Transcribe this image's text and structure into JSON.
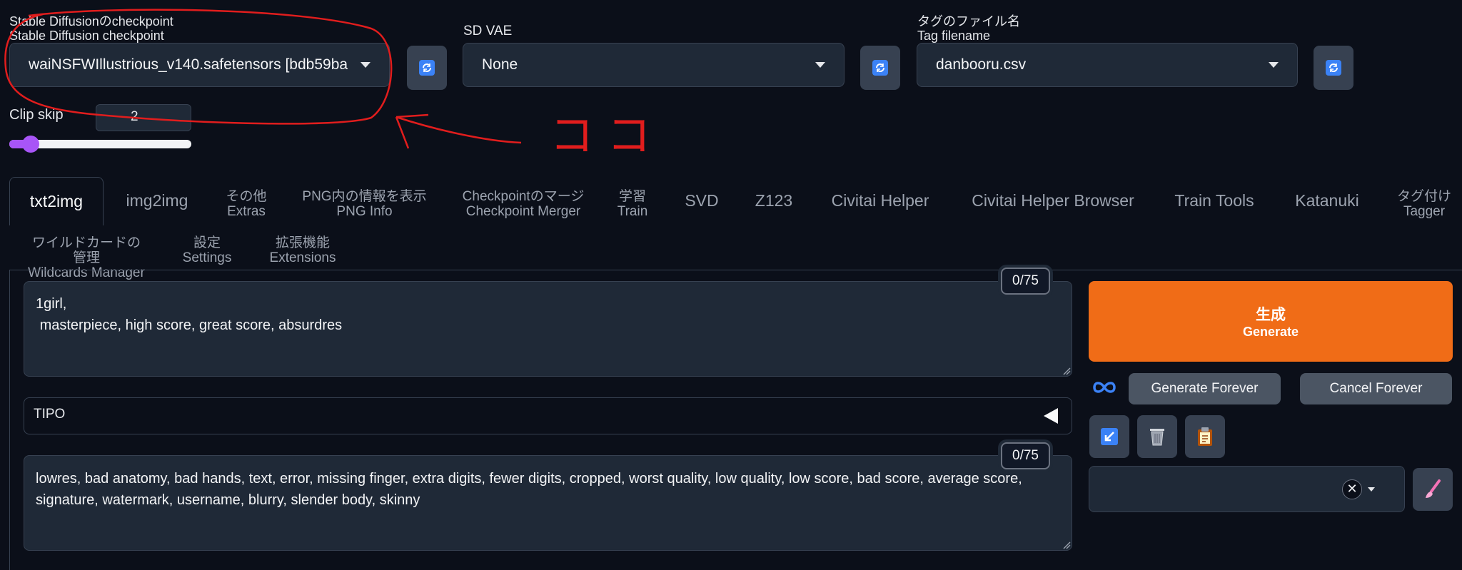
{
  "checkpoint": {
    "label_ja": "Stable Diffusionのcheckpoint",
    "label_en": "Stable Diffusion checkpoint",
    "value": "waiNSFWIllustrious_v140.safetensors [bdb59ba"
  },
  "vae": {
    "label": "SD VAE",
    "value": "None"
  },
  "tag_file": {
    "label_ja": "タグのファイル名",
    "label_en": "Tag filename",
    "value": "danbooru.csv"
  },
  "clip_skip": {
    "label": "Clip skip",
    "value": "2",
    "slider_fraction": 0.08
  },
  "annotation": {
    "text": "ココ",
    "color": "#e11d1d"
  },
  "tabs": [
    {
      "label": "txt2img"
    },
    {
      "label": "img2img"
    },
    {
      "line1": "その他",
      "line2": "Extras"
    },
    {
      "line1": "PNG内の情報を表示",
      "line2": "PNG Info"
    },
    {
      "line1": "Checkpointのマージ",
      "line2": "Checkpoint Merger"
    },
    {
      "line1": "学習",
      "line2": "Train"
    },
    {
      "label": "SVD"
    },
    {
      "label": "Z123"
    },
    {
      "label": "Civitai Helper"
    },
    {
      "label": "Civitai Helper Browser"
    },
    {
      "label": "Train Tools"
    },
    {
      "label": "Katanuki"
    },
    {
      "line1": "タグ付け",
      "line2": "Tagger"
    },
    {
      "line1": "ワイルドカードの管理",
      "line2": "Wildcards Manager"
    },
    {
      "line1": "設定",
      "line2": "Settings"
    },
    {
      "line1": "拡張機能",
      "line2": "Extensions"
    }
  ],
  "prompt": {
    "counter": "0/75",
    "text": "1girl,\n masterpiece, high score, great score, absurdres"
  },
  "tipo": {
    "label": "TIPO"
  },
  "negative_prompt": {
    "counter": "0/75",
    "text": "lowres, bad anatomy, bad hands, text, error, missing finger, extra digits, fewer digits, cropped, worst quality, low quality, low score, bad score, average score, signature, watermark, username, blurry, slender body, skinny"
  },
  "generate": {
    "line1": "生成",
    "line2": "Generate",
    "color": "#f06c17"
  },
  "generate_forever_label": "Generate Forever",
  "cancel_forever_label": "Cancel Forever",
  "icons": {
    "refresh": "refresh-icon",
    "infinity": "infinity-icon",
    "arrow": "read-params-icon",
    "trash": "trash-icon",
    "clipboard": "clipboard-icon",
    "clear": "clear-icon",
    "paint": "paintbrush-icon"
  }
}
